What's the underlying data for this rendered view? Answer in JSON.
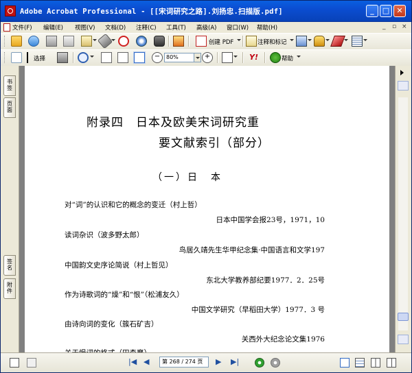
{
  "window": {
    "title": "Adobe Acrobat Professional - [[宋词研究之路].刘扬忠.扫描版.pdf]",
    "minimize": "_",
    "maximize": "□",
    "close": "✕"
  },
  "menu": {
    "items": [
      "文件(F)",
      "编辑(E)",
      "视图(V)",
      "文档(D)",
      "注释(C)",
      "工具(T)",
      "高级(A)",
      "窗口(W)",
      "帮助(H)"
    ],
    "mdi_minimize": "_",
    "mdi_restore": "▫",
    "mdi_close": "×"
  },
  "toolbar1": {
    "create_pdf": "创建 PDF",
    "comment_markup": "注释和标记"
  },
  "toolbar2": {
    "select": "选择",
    "zoom_value": "80%",
    "help": "帮助"
  },
  "left_panel": {
    "tabs": [
      "书签",
      "页面",
      "签名",
      "附件"
    ]
  },
  "page": {
    "heading_line1": "附录四　日本及欧美宋词研究重",
    "heading_line2": "要文献索引（部分）",
    "section": "（一）日　本",
    "entries": [
      {
        "title": "对“词”的认识和它的概念的变迁（村上哲）",
        "source": "日本中国学会报23号，1971，10"
      },
      {
        "title": "读词杂识（波多野太郎）",
        "source": "鸟居久靖先生华甲纪念集·中国语言和文学197"
      },
      {
        "title": "中国韵文史序论简说（村上哲见）",
        "source": "东北大学教养部纪要1977．2．25号"
      },
      {
        "title": "作为诗歌词的“燥”和“恨”（松浦友久）",
        "source": "中国文学研究（早稻田大学）1977．3 号"
      },
      {
        "title": "由诗向词的变化（簇石矿吉）",
        "source": "关西外大纪念论文集1976"
      },
      {
        "title": "关于慢词的格式（田森襄）",
        "source": ""
      }
    ]
  },
  "statusbar": {
    "page_indicator": "第 268 / 274 页"
  }
}
